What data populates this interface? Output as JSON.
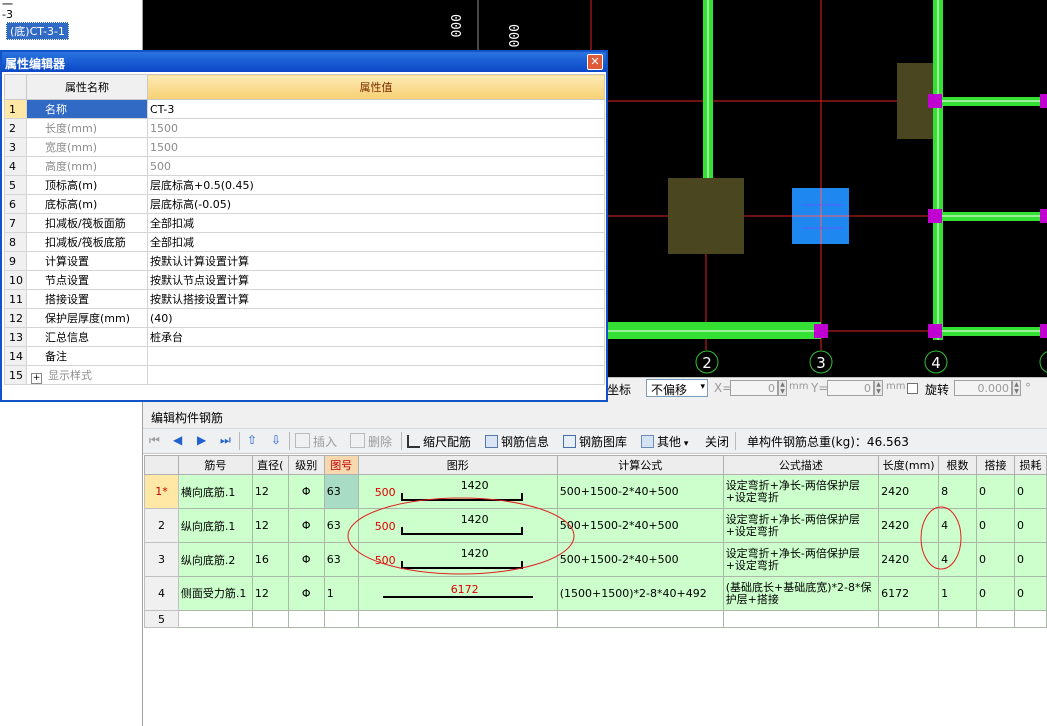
{
  "tree": {
    "line1": "一",
    "line2": "-3",
    "selected": "(底)CT-3-1"
  },
  "cad": {
    "dim_label_1": "000",
    "dim_label_2": "000",
    "axes": [
      "2",
      "3",
      "4"
    ]
  },
  "coordbar": {
    "coord_label": "坐标",
    "offset_mode": "不偏移",
    "x_label": "X=",
    "x_value": "0",
    "x_unit": "mm",
    "y_label": "Y=",
    "y_value": "0",
    "y_unit": "mm",
    "rotate_label": "旋转",
    "rotate_value": "0.000",
    "rotate_unit": "°"
  },
  "panel": {
    "title": "编辑构件钢筋",
    "toolbar": {
      "insert": "插入",
      "delete": "删除",
      "scale_rebar": "缩尺配筋",
      "rebar_info": "钢筋信息",
      "rebar_library": "钢筋图库",
      "other": "其他",
      "close": "关闭",
      "total_weight": "单构件钢筋总重(kg)：46.563"
    },
    "headers": [
      "",
      "筋号",
      "直径(",
      "级别",
      "图号",
      "图形",
      "计算公式",
      "公式描述",
      "长度(mm)",
      "根数",
      "搭接",
      "损耗"
    ],
    "rows": [
      {
        "rn": "1*",
        "name": "横向底筋.1",
        "dia": "12",
        "grade": "Φ",
        "fig": "63",
        "hook": "500",
        "len": "1420",
        "formula": "500+1500-2*40+500",
        "desc": "设定弯折+净长-两倍保护层+设定弯折",
        "length": "2420",
        "count": "8",
        "lap": "0",
        "loss": "0"
      },
      {
        "rn": "2",
        "name": "纵向底筋.1",
        "dia": "12",
        "grade": "Φ",
        "fig": "63",
        "hook": "500",
        "len": "1420",
        "formula": "500+1500-2*40+500",
        "desc": "设定弯折+净长-两倍保护层+设定弯折",
        "length": "2420",
        "count": "4",
        "lap": "0",
        "loss": "0"
      },
      {
        "rn": "3",
        "name": "纵向底筋.2",
        "dia": "16",
        "grade": "Φ",
        "fig": "63",
        "hook": "500",
        "len": "1420",
        "formula": "500+1500-2*40+500",
        "desc": "设定弯折+净长-两倍保护层+设定弯折",
        "length": "2420",
        "count": "4",
        "lap": "0",
        "loss": "0"
      },
      {
        "rn": "4",
        "name": "侧面受力筋.1",
        "dia": "12",
        "grade": "Φ",
        "fig": "1",
        "hook": "",
        "len": "6172",
        "formula": "(1500+1500)*2-8*40+492",
        "desc": "(基础底长+基础底宽)*2-8*保护层+搭接",
        "length": "6172",
        "count": "1",
        "lap": "0",
        "loss": "0"
      },
      {
        "rn": "5",
        "name": "",
        "dia": "",
        "grade": "",
        "fig": "",
        "hook": "",
        "len": "",
        "formula": "",
        "desc": "",
        "length": "",
        "count": "",
        "lap": "",
        "loss": ""
      }
    ]
  },
  "dialog": {
    "title": "属性编辑器",
    "col_name": "属性名称",
    "col_value": "属性值",
    "rows": [
      {
        "n": "1",
        "name": "名称",
        "value": "CT-3",
        "gray": false
      },
      {
        "n": "2",
        "name": "长度(mm)",
        "value": "1500",
        "gray": true
      },
      {
        "n": "3",
        "name": "宽度(mm)",
        "value": "1500",
        "gray": true
      },
      {
        "n": "4",
        "name": "高度(mm)",
        "value": "500",
        "gray": true
      },
      {
        "n": "5",
        "name": "顶标高(m)",
        "value": "层底标高+0.5(0.45)",
        "gray": false
      },
      {
        "n": "6",
        "name": "底标高(m)",
        "value": "层底标高(-0.05)",
        "gray": false
      },
      {
        "n": "7",
        "name": "扣减板/筏板面筋",
        "value": "全部扣减",
        "gray": false
      },
      {
        "n": "8",
        "name": "扣减板/筏板底筋",
        "value": "全部扣减",
        "gray": false
      },
      {
        "n": "9",
        "name": "计算设置",
        "value": "按默认计算设置计算",
        "gray": false
      },
      {
        "n": "10",
        "name": "节点设置",
        "value": "按默认节点设置计算",
        "gray": false
      },
      {
        "n": "11",
        "name": "搭接设置",
        "value": "按默认搭接设置计算",
        "gray": false
      },
      {
        "n": "12",
        "name": "保护层厚度(mm)",
        "value": "(40)",
        "gray": false
      },
      {
        "n": "13",
        "name": "汇总信息",
        "value": "桩承台",
        "gray": false
      },
      {
        "n": "14",
        "name": "备注",
        "value": "",
        "gray": false
      },
      {
        "n": "15",
        "name": "显示样式",
        "value": "",
        "gray": true
      }
    ]
  }
}
